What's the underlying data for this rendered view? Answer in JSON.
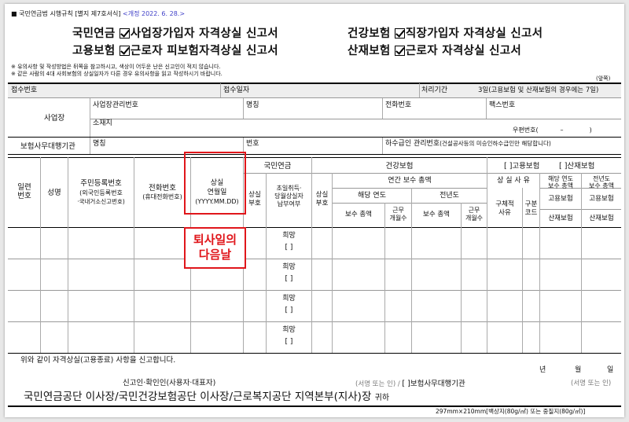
{
  "header": {
    "law": "■ 국민연금법 시행규칙 [별지 제7호서식]",
    "revision": "<개정 2022. 6. 28.>"
  },
  "titles": {
    "t1": "국민연금",
    "t1b": "사업장가입자 자격상실 신고서",
    "t2": "건강보험",
    "t2b": "직장가입자 자격상실 신고서",
    "t3": "고용보험",
    "t3b": "근로자 피보험자격상실 신고서",
    "t4": "산재보험",
    "t4b": "근로자 자격상실 신고서"
  },
  "notes": {
    "n1": "※ 유의사항 및 작성방법은 뒤쪽을 참고하시고, 색상이 어두운 난은 신고인이 적지 않습니다.",
    "n2": "※ 같은 사람의 4대 사회보험의 상실일자가 다른 경우 유의사항을 읽고 작성하시기 바랍니다.",
    "front": "(앞쪽)"
  },
  "receipt": {
    "no": "접수번호",
    "date": "접수일자",
    "period": "처리기간",
    "period_val": "3일(고용보험 및 산재보험의 경우에는 7일)"
  },
  "workplace": {
    "label": "사업장",
    "mgmt_no": "사업장관리번호",
    "name": "명칭",
    "phone": "전화번호",
    "fax": "팩스번호",
    "address": "소재지",
    "postal": "우편번호(",
    "postal_dash": "–",
    "postal_close": ")"
  },
  "agency": {
    "label": "보험사무대행기관",
    "name": "명칭",
    "number": "번호",
    "sewer": "하수급인 관리번호",
    "sewer_note": "(건설공사등의 미승인하수급인만 해당합니다)"
  },
  "table": {
    "serial": "일련\n번호",
    "name": "성명",
    "rrn": "주민등록번호",
    "rrn_sub1": "(외국인등록번호",
    "rrn_sub2": "·국내거소신고번호)",
    "phone": "전화번호",
    "phone_sub": "(휴대전화번호)",
    "loss_date": "상실\n연월일",
    "loss_fmt": "(YYYY.MM.DD)",
    "pension": "국민연금",
    "pension_code": "상실\n부호",
    "pension_refund": "초일취득·\n당월상실자\n납부여부",
    "health": "건강보험",
    "health_code": "상실\n부호",
    "annual": "연간 보수 총액",
    "this_year": "해당 연도",
    "prev_year": "전년도",
    "total_pay": "보수 총액",
    "months": "근무\n개월수",
    "employ": "[    ]고용보험",
    "accident": "[    ]산재보험",
    "loss_reason": "상 실 사 유",
    "cur_pay": "해당 연도\n보수 총액",
    "prev_pay": "전년도\n보수 총액",
    "specific": "구체적\n사유",
    "class_code": "구분\n코드",
    "emp_ins": "고용보험",
    "acc_ins": "산재보험",
    "hope": "희망",
    "bracket": "[    ]"
  },
  "annotation": "퇴사일의\n다음날",
  "footer": {
    "declare": "위와 같이 자격상실(고용종료) 사항을 신고합니다.",
    "year": "년",
    "month": "월",
    "day": "일",
    "reporter": "신고인·확인인(사용자·대표자)",
    "sign1": "(서명 또는 인) /",
    "agency": "[    ]보험사무대행기관",
    "sign2": "(서명 또는 인)",
    "recipient": "국민연금공단 이사장/국민건강보험공단 이사장/근로복지공단 지역본부(지사)장",
    "honor": "귀하",
    "paper": "297mm×210mm[백상지(80g/㎡) 또는 중질지(80g/㎡)]"
  }
}
